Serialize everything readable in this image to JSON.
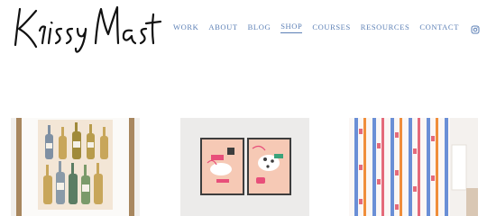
{
  "brand": {
    "logo_text": "Krissy Mast"
  },
  "nav": {
    "items": [
      {
        "label": "WORK"
      },
      {
        "label": "ABOUT"
      },
      {
        "label": "BLOG"
      },
      {
        "label": "SHOP",
        "active": true
      },
      {
        "label": "COURSES"
      },
      {
        "label": "RESOURCES"
      },
      {
        "label": "CONTACT"
      }
    ],
    "instagram_icon": "instagram-icon",
    "link_color": "#5b7fb5"
  },
  "products": [
    {
      "image": "champagne-bottles-art-print"
    },
    {
      "image": "framed-pink-art-prints"
    },
    {
      "image": "patterned-shower-curtain"
    }
  ]
}
